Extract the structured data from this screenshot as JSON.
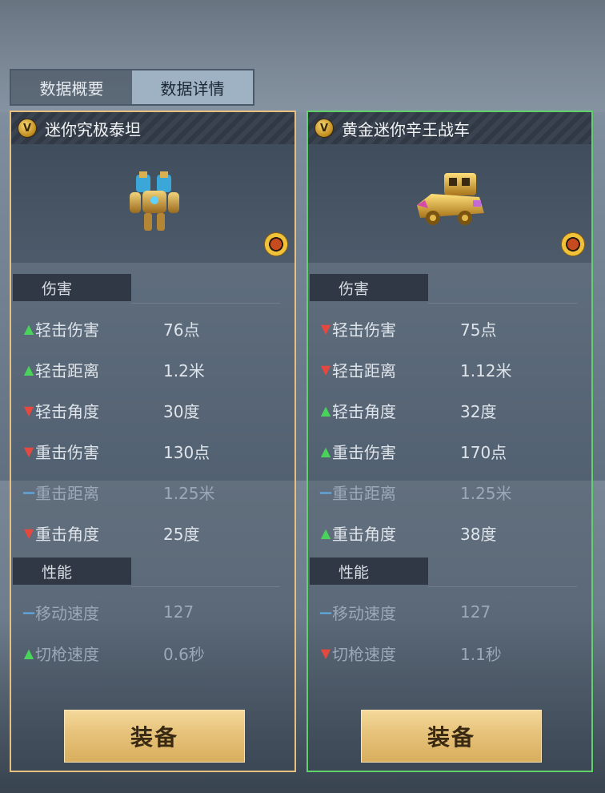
{
  "tabs": [
    {
      "label": "数据概要",
      "active": false
    },
    {
      "label": "数据详情",
      "active": true
    }
  ],
  "colors": {
    "left_border": "#e7c07d",
    "right_border": "#5fd36a",
    "up": "#49d35a",
    "down": "#e5483f",
    "same": "#5fb0ea"
  },
  "panels": [
    {
      "badge": "V",
      "title": "迷你究极泰坦",
      "image": "mech-titan-figure",
      "section_damage": "伤害",
      "section_performance": "性能",
      "damage_stats": [
        {
          "name": "轻击伤害",
          "value": "76点",
          "trend": "up"
        },
        {
          "name": "轻击距离",
          "value": "1.2米",
          "trend": "up"
        },
        {
          "name": "轻击角度",
          "value": "30度",
          "trend": "down"
        },
        {
          "name": "重击伤害",
          "value": "130点",
          "trend": "down"
        },
        {
          "name": "重击距离",
          "value": "1.25米",
          "trend": "same"
        },
        {
          "name": "重击角度",
          "value": "25度",
          "trend": "down"
        }
      ],
      "performance_stats": [
        {
          "name": "移动速度",
          "value": "127",
          "trend": "same"
        },
        {
          "name": "切枪速度",
          "value": "0.6秒",
          "trend": "up"
        }
      ],
      "equip_label": "装备"
    },
    {
      "badge": "V",
      "title": "黄金迷你辛王战车",
      "image": "golden-war-chariot",
      "section_damage": "伤害",
      "section_performance": "性能",
      "damage_stats": [
        {
          "name": "轻击伤害",
          "value": "75点",
          "trend": "down"
        },
        {
          "name": "轻击距离",
          "value": "1.12米",
          "trend": "down"
        },
        {
          "name": "轻击角度",
          "value": "32度",
          "trend": "up"
        },
        {
          "name": "重击伤害",
          "value": "170点",
          "trend": "up"
        },
        {
          "name": "重击距离",
          "value": "1.25米",
          "trend": "same"
        },
        {
          "name": "重击角度",
          "value": "38度",
          "trend": "up"
        }
      ],
      "performance_stats": [
        {
          "name": "移动速度",
          "value": "127",
          "trend": "same"
        },
        {
          "name": "切枪速度",
          "value": "1.1秒",
          "trend": "down"
        }
      ],
      "equip_label": "装备"
    }
  ]
}
